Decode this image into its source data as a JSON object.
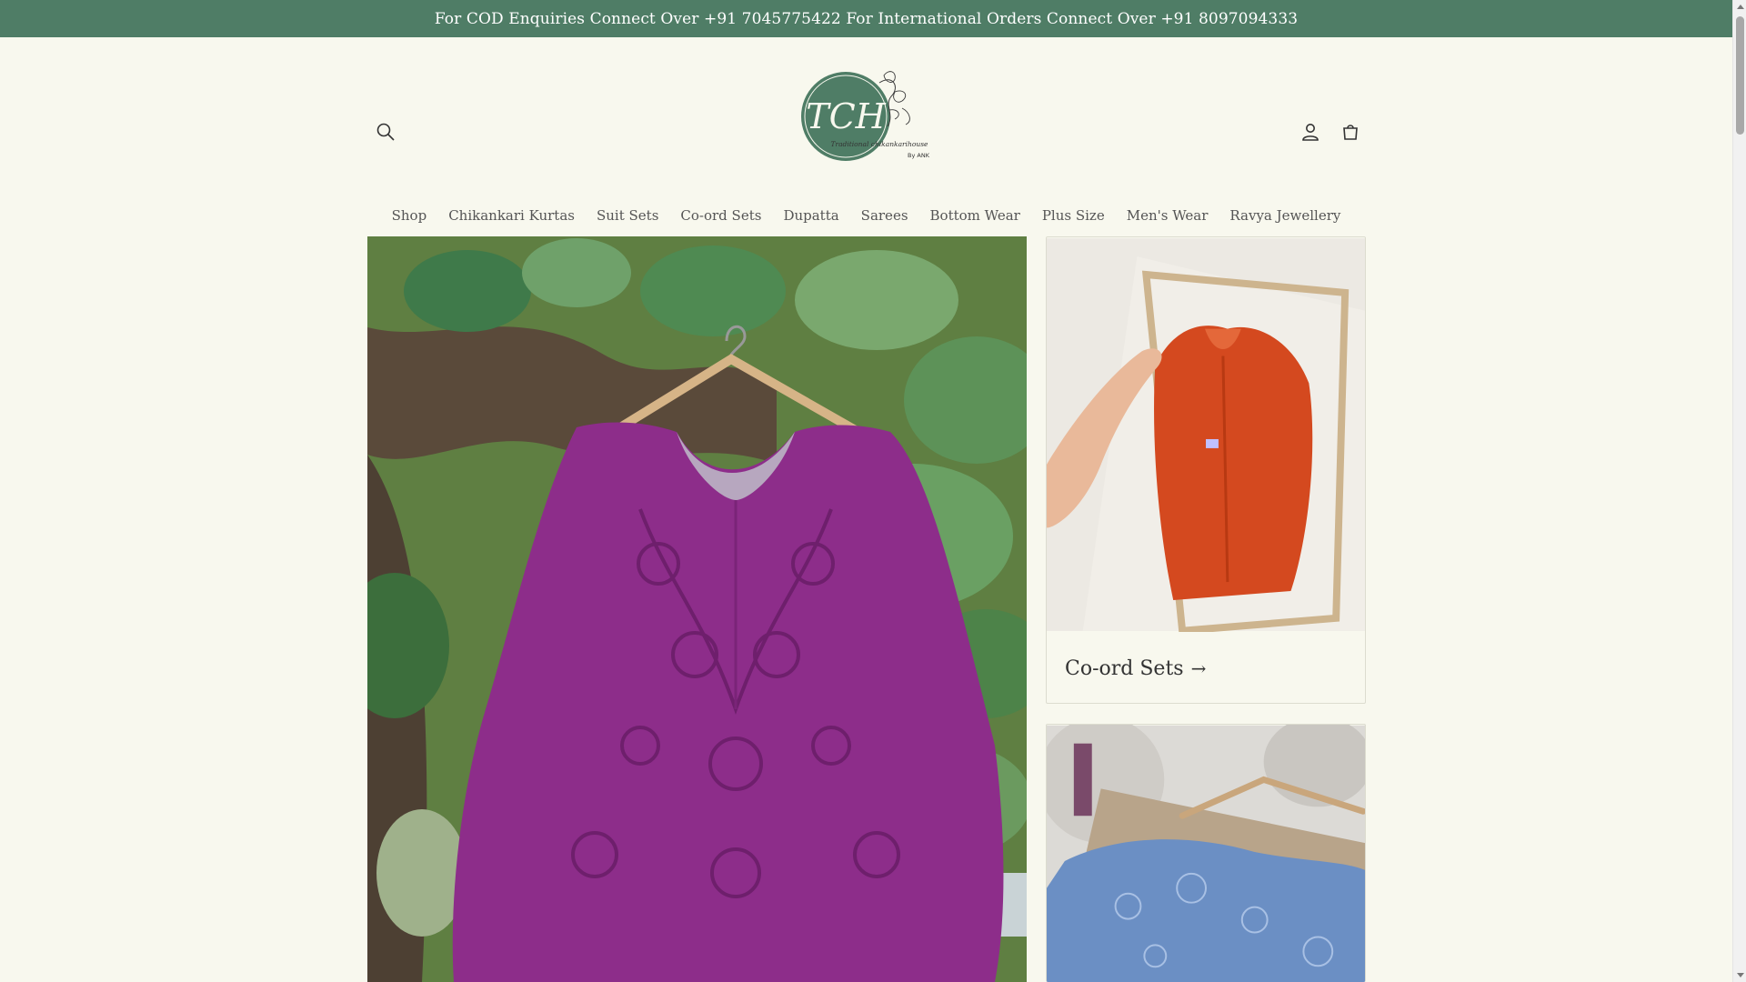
{
  "announcement": {
    "text": "For COD Enquiries Connect Over +91 7045775422 For International Orders Connect Over +91 8097094333"
  },
  "header": {
    "logo_text": "TCH",
    "logo_tagline": "Traditional chikankarihouse",
    "logo_by": "By ANK",
    "icons": {
      "search": "search-icon",
      "account": "account-icon",
      "cart": "cart-icon"
    }
  },
  "nav": {
    "items": [
      "Shop",
      "Chikankari Kurtas",
      "Suit Sets",
      "Co-ord Sets",
      "Dupatta",
      "Sarees",
      "Bottom Wear",
      "Plus Size",
      "Men's Wear",
      "Ravya Jewellery"
    ]
  },
  "collections": {
    "card1": {
      "label": "Co-ord Sets",
      "arrow": "→"
    }
  },
  "colors": {
    "announcement_bg": "#4f7d66",
    "page_bg": "#f8f8ee",
    "logo_green": "#4f7d66"
  }
}
